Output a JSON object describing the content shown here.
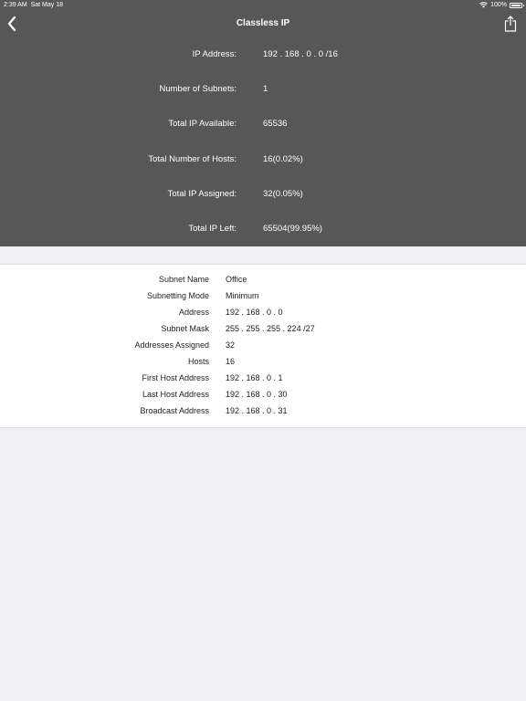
{
  "status_bar": {
    "time": "2:39 AM",
    "date": "Sat May 18",
    "battery": "100%"
  },
  "nav": {
    "title": "Classless IP",
    "back_icon": "chevron-left-icon",
    "share_icon": "share-icon"
  },
  "summary": [
    {
      "label": "IP Address:",
      "value": "192 . 168 . 0 . 0 /16"
    },
    {
      "label": "Number of Subnets:",
      "value": "1"
    },
    {
      "label": "Total IP Available:",
      "value": "65536"
    },
    {
      "label": "Total Number of Hosts:",
      "value": "16(0.02%)"
    },
    {
      "label": "Total IP Assigned:",
      "value": "32(0.05%)"
    },
    {
      "label": "Total IP Left:",
      "value": "65504(99.95%)"
    }
  ],
  "subnet": [
    {
      "label": "Subnet Name",
      "value": "Office"
    },
    {
      "label": "Subnetting Mode",
      "value": "Minimum"
    },
    {
      "label": "Address",
      "value": "192 . 168 . 0 . 0"
    },
    {
      "label": "Subnet Mask",
      "value": "255 . 255 . 255 . 224 /27"
    },
    {
      "label": "Addresses Assigned",
      "value": "32"
    },
    {
      "label": "Hosts",
      "value": "16"
    },
    {
      "label": "First Host Address",
      "value": "192 . 168 . 0 . 1"
    },
    {
      "label": "Last Host Address",
      "value": "192 . 168 . 0 . 30"
    },
    {
      "label": "Broadcast Address",
      "value": "192 . 168 . 0 . 31"
    }
  ],
  "colors": {
    "header_bg": "#575757",
    "page_bg": "#efeff4",
    "card_bg": "#ffffff"
  }
}
